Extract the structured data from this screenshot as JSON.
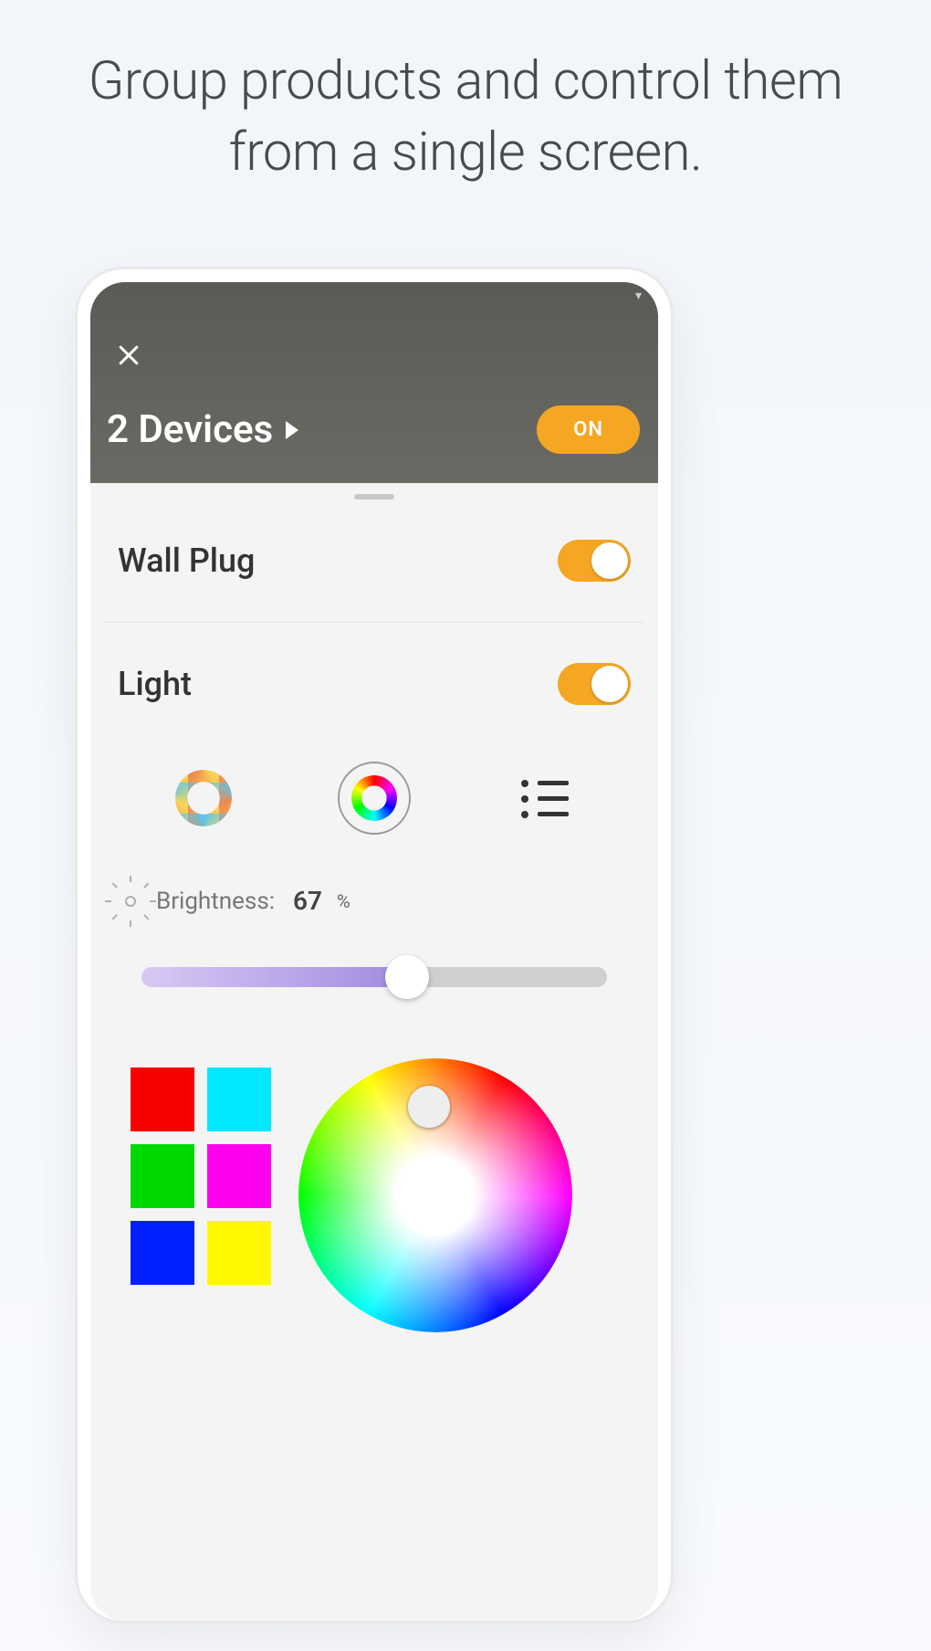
{
  "headline": "Group products and control them from a single screen.",
  "header": {
    "title": "2 Devices",
    "power_button": "ON"
  },
  "devices": [
    {
      "name": "Wall Plug",
      "on": true
    },
    {
      "name": "Light",
      "on": true
    }
  ],
  "brightness": {
    "label": "Brightness:",
    "value": "67",
    "unit": "%"
  },
  "color_swatches": [
    "#f60000",
    "#00e8ff",
    "#00d900",
    "#ff00ee",
    "#0020ff",
    "#fff800"
  ],
  "modes": {
    "temperature_selected": false,
    "rgb_selected": true,
    "list_selected": false
  },
  "slider_percent": 57
}
